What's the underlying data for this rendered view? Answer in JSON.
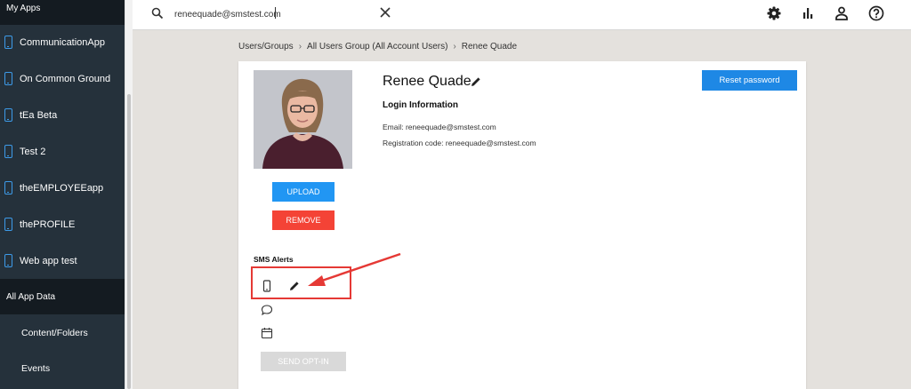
{
  "sidebar": {
    "header": "My Apps",
    "apps": [
      {
        "label": "CommunicationApp"
      },
      {
        "label": "On Common Ground"
      },
      {
        "label": "tEa Beta"
      },
      {
        "label": "Test 2"
      },
      {
        "label": "theEMPLOYEEapp"
      },
      {
        "label": "thePROFILE"
      },
      {
        "label": "Web app test"
      }
    ],
    "section": "All App Data",
    "sub_items": [
      {
        "label": "Content/Folders"
      },
      {
        "label": "Events"
      }
    ]
  },
  "search": {
    "value": "reneequade@smstest.com",
    "icon": "search-icon",
    "clear_icon": "close-icon"
  },
  "topbar_icons": [
    "gear-icon",
    "bar-chart-icon",
    "person-icon",
    "help-circle-icon"
  ],
  "breadcrumb": {
    "items": [
      "Users/Groups",
      "All Users Group (All Account Users)",
      "Renee Quade"
    ],
    "separator": "›"
  },
  "profile": {
    "name": "Renee Quade",
    "login_heading": "Login Information",
    "email": "Email: reneequade@smstest.com",
    "registration": "Registration code: reneequade@smstest.com",
    "upload_label": "UPLOAD",
    "remove_label": "REMOVE",
    "reset_label": "Reset password"
  },
  "sms": {
    "heading": "SMS Alerts",
    "optin_label": "SEND OPT-IN"
  },
  "colors": {
    "sidebar_bg": "#25313b",
    "sidebar_dark": "#141b21",
    "accent_blue": "#2196f3",
    "danger_red": "#f44336",
    "annotation_red": "#e53935"
  }
}
